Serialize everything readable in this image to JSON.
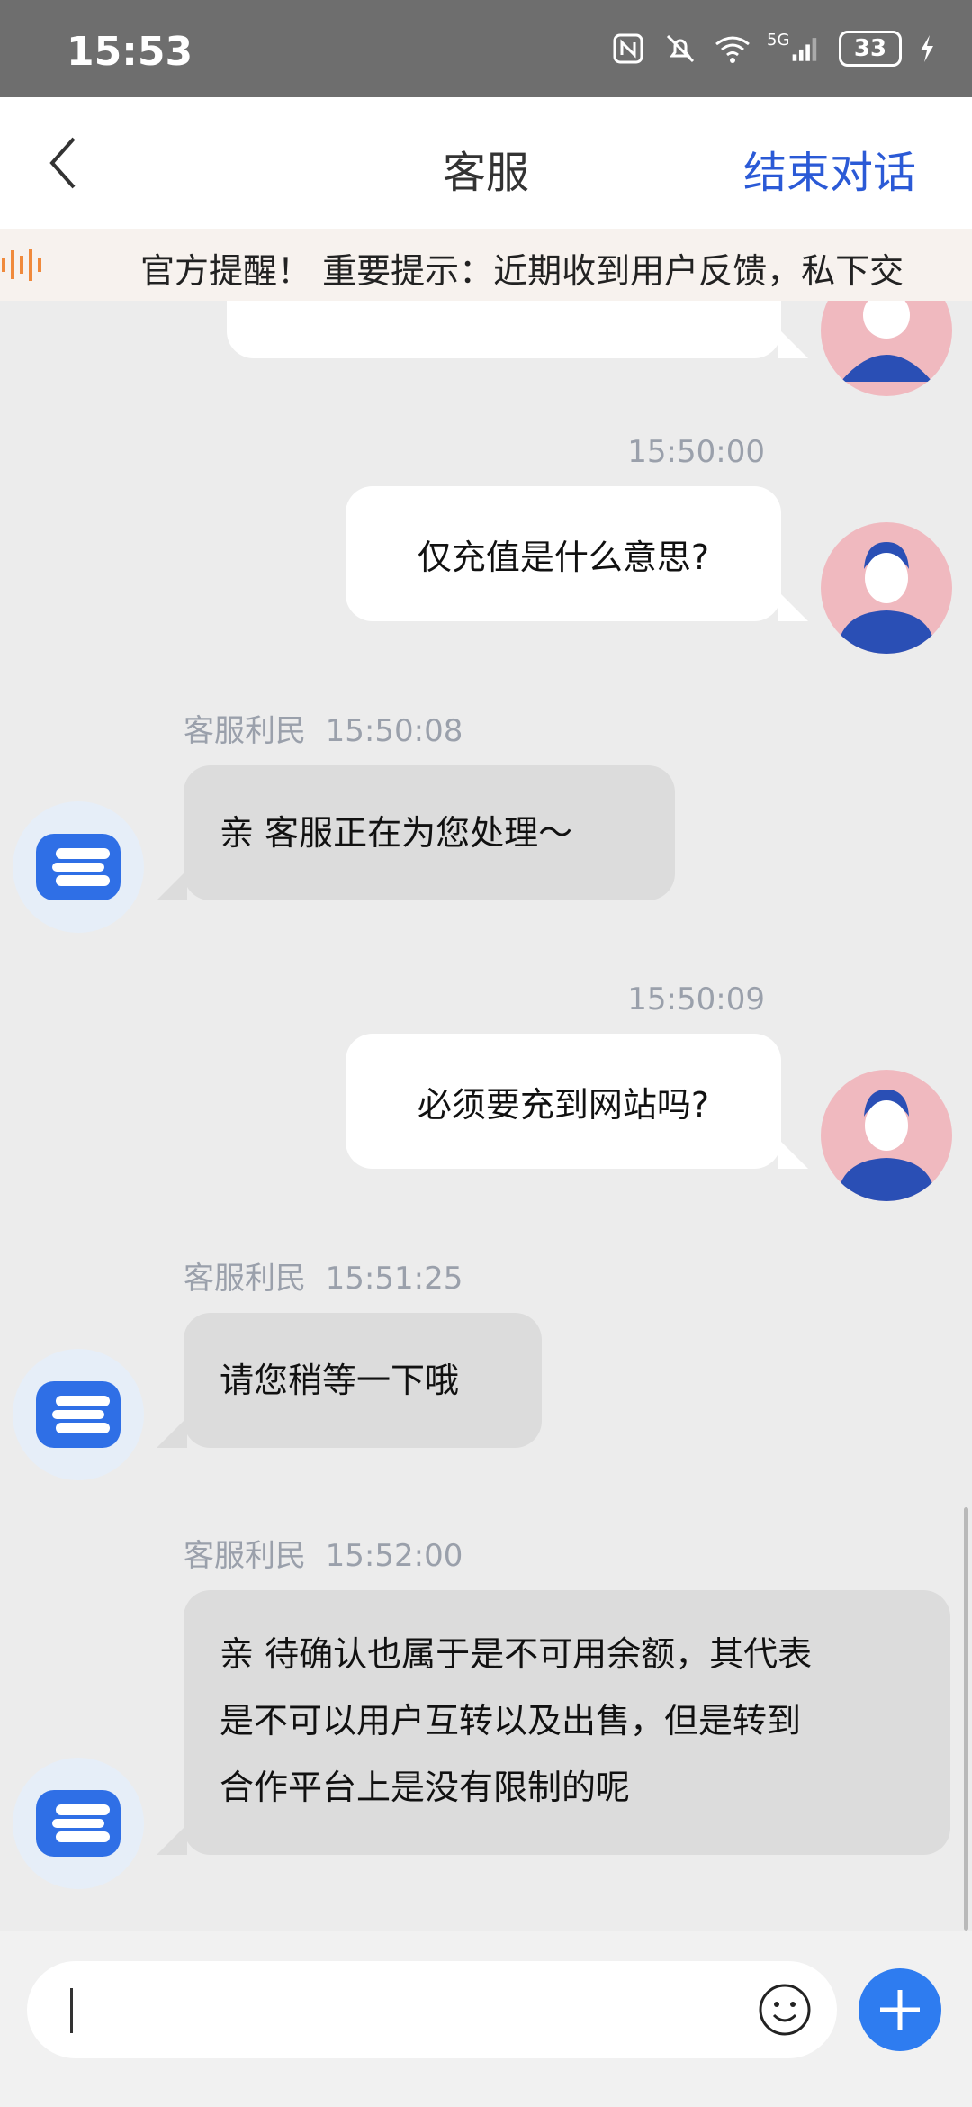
{
  "status": {
    "time": "15:53",
    "battery": "33",
    "network": "5G"
  },
  "nav": {
    "title": "客服",
    "end_label": "结束对话"
  },
  "notice": {
    "text": "官方提醒！ 重要提示：近期收到用户反馈，私下交"
  },
  "messages": [
    {
      "side": "right",
      "time": "15:50:00",
      "text": "仅充值是什么意思?"
    },
    {
      "side": "left",
      "sender": "客服利民",
      "time": "15:50:08",
      "text": "亲 客服正在为您处理～"
    },
    {
      "side": "right",
      "time": "15:50:09",
      "text": "必须要充到网站吗?"
    },
    {
      "side": "left",
      "sender": "客服利民",
      "time": "15:51:25",
      "text": "请您稍等一下哦"
    },
    {
      "side": "left",
      "sender": "客服利民",
      "time": "15:52:00",
      "lines": [
        "亲 待确认也属于是不可用余额，其代表",
        "是不可以用户互转以及出售，但是转到",
        "合作平台上是没有限制的呢"
      ]
    }
  ],
  "colors": {
    "accent": "#2b5ad6",
    "plus": "#2e7cf0",
    "notice_icon": "#f08a3c"
  }
}
